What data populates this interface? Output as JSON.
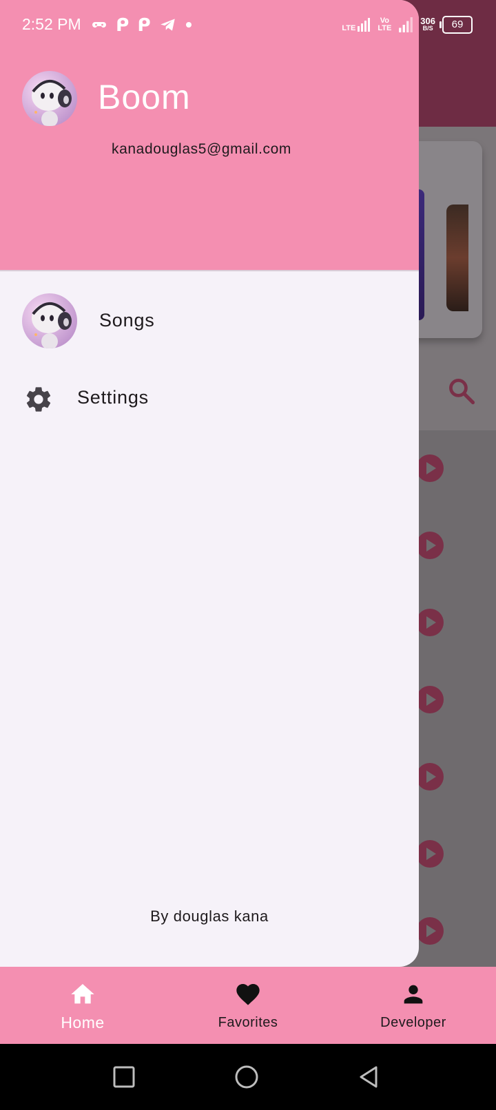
{
  "status_bar": {
    "time": "2:52 PM",
    "network_speed_value": "306",
    "network_speed_unit": "B/S",
    "battery": "69",
    "lte_label": "LTE",
    "volte_label_top": "Vo",
    "volte_label_bottom": "LTE"
  },
  "drawer": {
    "user_name": "Boom",
    "user_email": "kanadouglas5@gmail.com",
    "items": [
      {
        "label": "Songs",
        "icon": "avatar-image"
      },
      {
        "label": "Settings",
        "icon": "gear-icon"
      }
    ],
    "footer": "By douglas kana"
  },
  "bottom_nav": {
    "items": [
      {
        "label": "Home",
        "icon": "home-icon",
        "active": true
      },
      {
        "label": "Favorites",
        "icon": "heart-icon",
        "active": false
      },
      {
        "label": "Developer",
        "icon": "person-icon",
        "active": false
      }
    ]
  },
  "colors": {
    "accent_pink": "#f48fb1",
    "drawer_surface": "#f6f2f9",
    "background_primary_dimmed": "#6e2c44",
    "play_button_dimmed": "#7a3048"
  }
}
